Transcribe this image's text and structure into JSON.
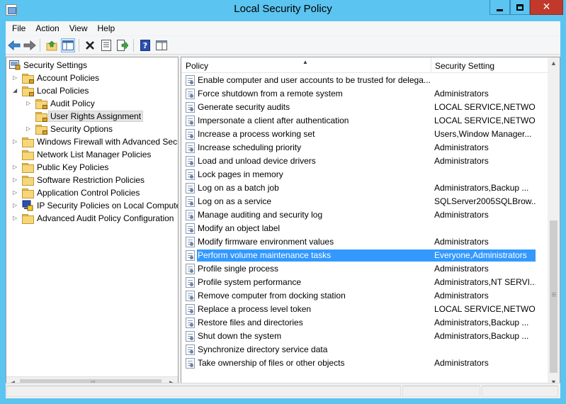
{
  "window": {
    "title": "Local Security Policy",
    "close_glyph": "✕"
  },
  "menubar": {
    "items": [
      "File",
      "Action",
      "View",
      "Help"
    ]
  },
  "toolbar": {
    "buttons": [
      "back-icon",
      "forward-icon",
      "up-folder-icon",
      "show-hide-tree-icon",
      "delete-icon",
      "properties-icon",
      "export-list-icon",
      "help-icon",
      "show-pane-icon"
    ]
  },
  "tree": {
    "root": "Security Settings",
    "items": [
      {
        "label": "Account Policies"
      },
      {
        "label": "Local Policies"
      },
      {
        "label": "Audit Policy"
      },
      {
        "label": "User Rights Assignment"
      },
      {
        "label": "Security Options"
      },
      {
        "label": "Windows Firewall with Advanced Secu"
      },
      {
        "label": "Network List Manager Policies"
      },
      {
        "label": "Public Key Policies"
      },
      {
        "label": "Software Restriction Policies"
      },
      {
        "label": "Application Control Policies"
      },
      {
        "label": "IP Security Policies on Local Compute"
      },
      {
        "label": "Advanced Audit Policy Configuration"
      }
    ],
    "hscroll_grip": "III"
  },
  "list": {
    "columns": {
      "policy": "Policy",
      "setting": "Security Setting"
    },
    "rows": [
      {
        "policy": "Enable computer and user accounts to be trusted for delega...",
        "setting": ""
      },
      {
        "policy": "Force shutdown from a remote system",
        "setting": "Administrators"
      },
      {
        "policy": "Generate security audits",
        "setting": "LOCAL SERVICE,NETWO..."
      },
      {
        "policy": "Impersonate a client after authentication",
        "setting": "LOCAL SERVICE,NETWO..."
      },
      {
        "policy": "Increase a process working set",
        "setting": "Users,Window Manager..."
      },
      {
        "policy": "Increase scheduling priority",
        "setting": "Administrators"
      },
      {
        "policy": "Load and unload device drivers",
        "setting": "Administrators"
      },
      {
        "policy": "Lock pages in memory",
        "setting": ""
      },
      {
        "policy": "Log on as a batch job",
        "setting": "Administrators,Backup ..."
      },
      {
        "policy": "Log on as a service",
        "setting": "SQLServer2005SQLBrow..."
      },
      {
        "policy": "Manage auditing and security log",
        "setting": "Administrators"
      },
      {
        "policy": "Modify an object label",
        "setting": ""
      },
      {
        "policy": "Modify firmware environment values",
        "setting": "Administrators"
      },
      {
        "policy": "Perform volume maintenance tasks",
        "setting": "Everyone,Administrators"
      },
      {
        "policy": "Profile single process",
        "setting": "Administrators"
      },
      {
        "policy": "Profile system performance",
        "setting": "Administrators,NT SERVI..."
      },
      {
        "policy": "Remove computer from docking station",
        "setting": "Administrators"
      },
      {
        "policy": "Replace a process level token",
        "setting": "LOCAL SERVICE,NETWO..."
      },
      {
        "policy": "Restore files and directories",
        "setting": "Administrators,Backup ..."
      },
      {
        "policy": "Shut down the system",
        "setting": "Administrators,Backup ..."
      },
      {
        "policy": "Synchronize directory service data",
        "setting": ""
      },
      {
        "policy": "Take ownership of files or other objects",
        "setting": "Administrators"
      }
    ],
    "vscroll_grip": "III"
  },
  "colors": {
    "title_bar": "#5bc4f0",
    "selection": "#3399ff",
    "close_button": "#c0392b"
  }
}
